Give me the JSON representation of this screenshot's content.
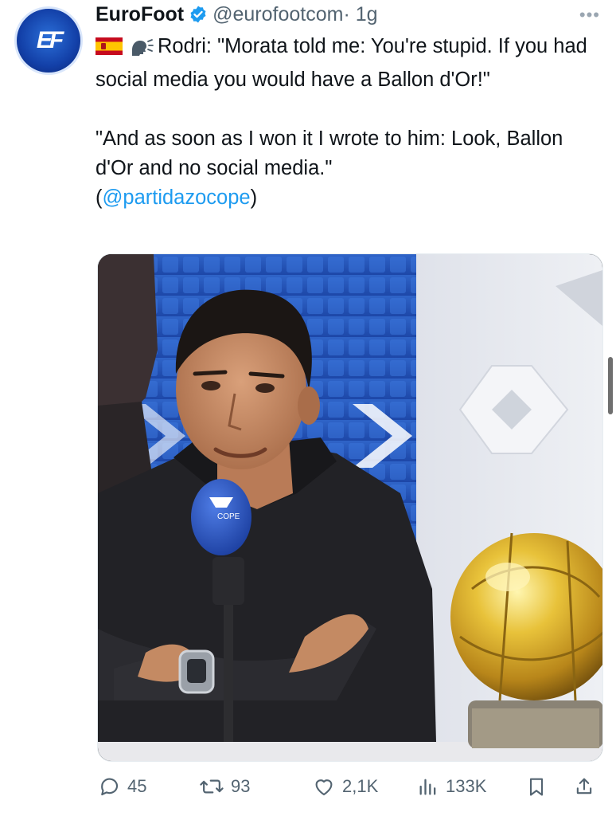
{
  "author": {
    "name": "EuroFoot",
    "handle": "@eurofootcom",
    "time": "· 1g",
    "avatar_monogram": "EF",
    "verified": true
  },
  "more_icon": "more-horizontal-icon",
  "tweet": {
    "line1_suffix": "Rodri: \"Morata told me: You're stupid. If you had social media you would have a Ballon d'Or!\"",
    "line2": "\"And as soon as I won it I wrote to him: Look, Ballon d'Or and no social media.\"",
    "mention_open": "(",
    "mention": "@partidazocope",
    "mention_close": ")"
  },
  "media": {
    "description_icon": "photo",
    "mic_logo": "COPE"
  },
  "actions": {
    "replies": "45",
    "reposts": "93",
    "likes": "2,1K",
    "views": "133K"
  },
  "colors": {
    "accent": "#1d9bf0",
    "muted": "#536471",
    "text": "#0f1419"
  }
}
